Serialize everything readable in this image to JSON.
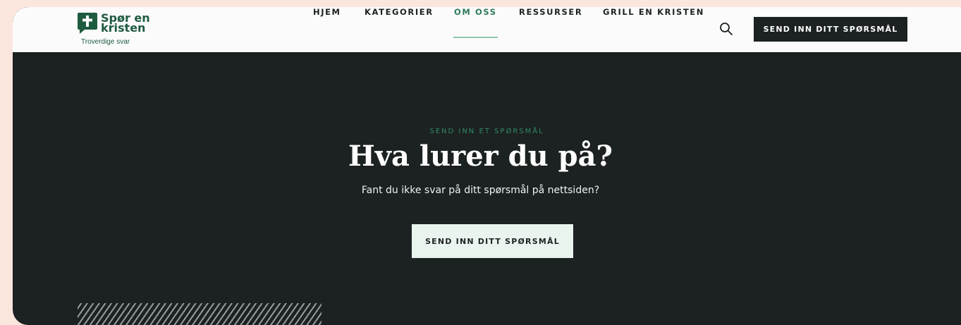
{
  "logo": {
    "line1": "Spør en",
    "line2": "kristen",
    "tagline": "Troverdige svar",
    "icon": "cross-speech-bubble-icon"
  },
  "nav": {
    "items": [
      {
        "label": "HJEM",
        "active": false
      },
      {
        "label": "KATEGORIER",
        "active": false
      },
      {
        "label": "OM OSS",
        "active": true
      },
      {
        "label": "RESSURSER",
        "active": false
      },
      {
        "label": "GRILL EN KRISTEN",
        "active": false
      }
    ],
    "search_icon": "search-icon",
    "cta_label": "SEND INN DITT SPØRSMÅL"
  },
  "hero": {
    "eyebrow": "SEND INN ET SPØRSMÅL",
    "title": "Hva lurer du på?",
    "subtitle": "Fant du ikke svar på ditt spørsmål på nettsiden?",
    "cta_label": "SEND INN DITT SPØRSMÅL"
  },
  "colors": {
    "page_background": "#fbe6de",
    "hero_background": "#1c2122",
    "brand_green": "#1f5b3f",
    "accent_green": "#2f8a62",
    "cta_light": "#eaf4ef"
  }
}
